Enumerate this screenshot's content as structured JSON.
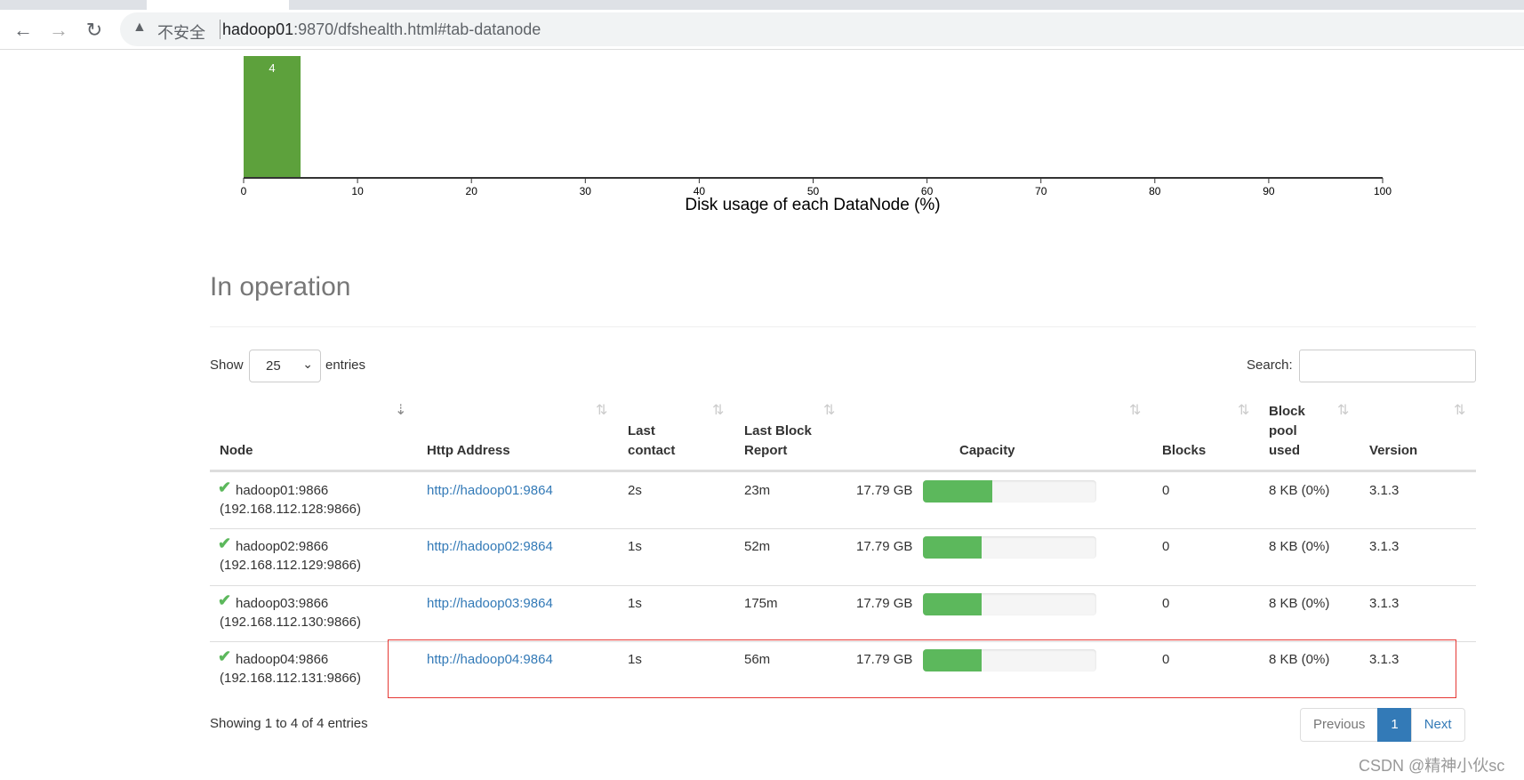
{
  "browser": {
    "security_label": "不安全",
    "url_host": "hadoop01",
    "url_rest": ":9870/dfshealth.html#tab-datanode"
  },
  "chart_data": {
    "type": "bar",
    "xlabel": "Disk usage of each DataNode (%)",
    "xlim": [
      0,
      100
    ],
    "xticks": [
      "0",
      "10",
      "20",
      "30",
      "40",
      "50",
      "60",
      "70",
      "80",
      "90",
      "100"
    ],
    "bins": [
      {
        "from": 0,
        "to": 5,
        "count": 4
      }
    ],
    "data_labels": [
      "4"
    ],
    "bar_color": "#5da13c"
  },
  "section": {
    "title": "In operation"
  },
  "controls": {
    "show_label": "Show",
    "entries_label": "entries",
    "page_size": "25",
    "search_label": "Search:",
    "search_value": ""
  },
  "table": {
    "headers": {
      "node": "Node",
      "http": "Http Address",
      "last_contact_1": "Last",
      "last_contact_2": "contact",
      "last_block_1": "Last Block",
      "last_block_2": "Report",
      "capacity": "Capacity",
      "blocks": "Blocks",
      "pool_1": "Block",
      "pool_2": "pool",
      "pool_3": "used",
      "version": "Version"
    },
    "rows": [
      {
        "node": "hadoop01:9866",
        "ip": "(192.168.112.128:9866)",
        "http": "http://hadoop01:9864",
        "contact": "2s",
        "report": "23m",
        "capacity": "17.79 GB",
        "used_pct": 40,
        "blocks": "0",
        "pool": "8 KB (0%)",
        "version": "3.1.3"
      },
      {
        "node": "hadoop02:9866",
        "ip": "(192.168.112.129:9866)",
        "http": "http://hadoop02:9864",
        "contact": "1s",
        "report": "52m",
        "capacity": "17.79 GB",
        "used_pct": 34,
        "blocks": "0",
        "pool": "8 KB (0%)",
        "version": "3.1.3"
      },
      {
        "node": "hadoop03:9866",
        "ip": "(192.168.112.130:9866)",
        "http": "http://hadoop03:9864",
        "contact": "1s",
        "report": "175m",
        "capacity": "17.79 GB",
        "used_pct": 34,
        "blocks": "0",
        "pool": "8 KB (0%)",
        "version": "3.1.3"
      },
      {
        "node": "hadoop04:9866",
        "ip": "(192.168.112.131:9866)",
        "http": "http://hadoop04:9864",
        "contact": "1s",
        "report": "56m",
        "capacity": "17.79 GB",
        "used_pct": 34,
        "blocks": "0",
        "pool": "8 KB (0%)",
        "version": "3.1.3"
      }
    ]
  },
  "footer": {
    "info": "Showing 1 to 4 of 4 entries",
    "prev": "Previous",
    "page": "1",
    "next": "Next"
  },
  "watermark": "CSDN @精神小伙sc"
}
